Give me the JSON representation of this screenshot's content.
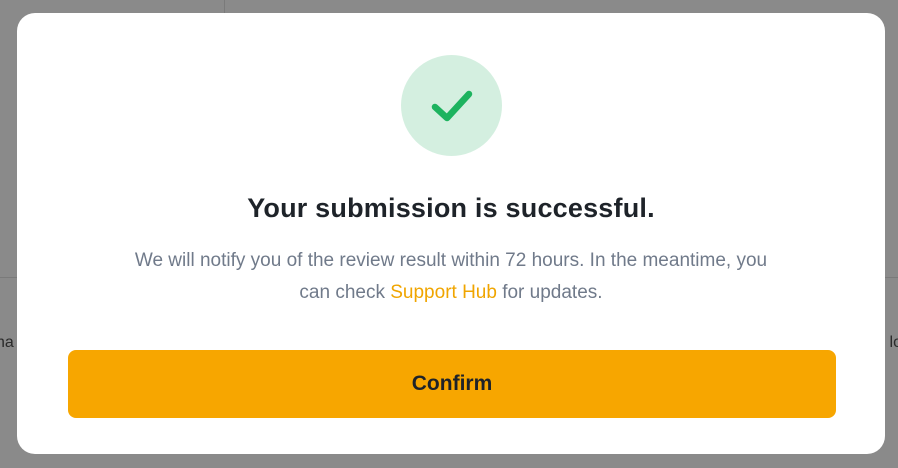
{
  "background": {
    "left_text": "ha",
    "right_text": "lo"
  },
  "dialog": {
    "icon": "checkmark-icon",
    "title": "Your submission is successful.",
    "message_line1": "We will notify you of the review result within 72 hours. In the meantime, you",
    "message_prefix": "can check ",
    "link_text": "Support Hub",
    "message_suffix": " for updates.",
    "confirm_label": "Confirm"
  },
  "colors": {
    "accent": "#F7A600",
    "success": "#1DB35F",
    "success_bg": "#D4EFE0",
    "link": "#F0A500"
  }
}
